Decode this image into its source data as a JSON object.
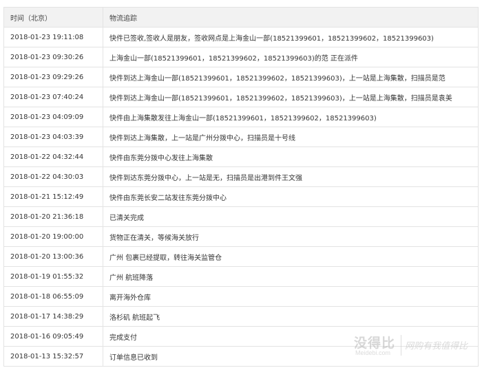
{
  "table": {
    "headers": {
      "time": "时间（北京）",
      "tracking": "物流追踪"
    },
    "rows": [
      {
        "time": "2018-01-23 19:11:08",
        "status": "快件已签收,签收人是朋友，签收网点是上海金山一部(18521399601，18521399602，18521399603)"
      },
      {
        "time": "2018-01-23 09:30:26",
        "status": "上海金山一部(18521399601，18521399602，18521399603)的范 正在派件"
      },
      {
        "time": "2018-01-23 09:29:26",
        "status": "快件到达上海金山一部(18521399601，18521399602，18521399603)，上一站是上海集散，扫描员是范"
      },
      {
        "time": "2018-01-23 07:40:24",
        "status": "快件到达上海金山一部(18521399601，18521399602，18521399603)，上一站是上海集散，扫描员是袁美"
      },
      {
        "time": "2018-01-23 04:09:09",
        "status": "快件由上海集散发往上海金山一部(18521399601，18521399602，18521399603)"
      },
      {
        "time": "2018-01-23 04:03:39",
        "status": "快件到达上海集散，上一站是广州分拨中心，扫描员是十号线"
      },
      {
        "time": "2018-01-22 04:32:44",
        "status": "快件由东莞分拨中心发往上海集散"
      },
      {
        "time": "2018-01-22 04:30:03",
        "status": "快件到达东莞分拨中心，上一站是无，扫描员是出港到件王文强"
      },
      {
        "time": "2018-01-21 15:12:49",
        "status": "快件由东莞长安二站发往东莞分拨中心"
      },
      {
        "time": "2018-01-20 21:36:18",
        "status": "已清关完成"
      },
      {
        "time": "2018-01-20 19:00:00",
        "status": "货物正在清关，等候海关放行"
      },
      {
        "time": "2018-01-20 13:00:36",
        "status": "广州 包裹已经提取，转往海关监管仓"
      },
      {
        "time": "2018-01-19 01:55:32",
        "status": "广州 航班降落"
      },
      {
        "time": "2018-01-18 06:55:09",
        "status": "离开海外仓库"
      },
      {
        "time": "2018-01-17 14:38:29",
        "status": "洛杉矶 航班起飞"
      },
      {
        "time": "2018-01-16 09:05:49",
        "status": "完成支付"
      },
      {
        "time": "2018-01-13 15:32:57",
        "status": "订单信息已收到"
      }
    ]
  },
  "watermark": {
    "logo": "没得比",
    "domain": "Meidebi.com",
    "slogan": "网购有我值得比"
  }
}
